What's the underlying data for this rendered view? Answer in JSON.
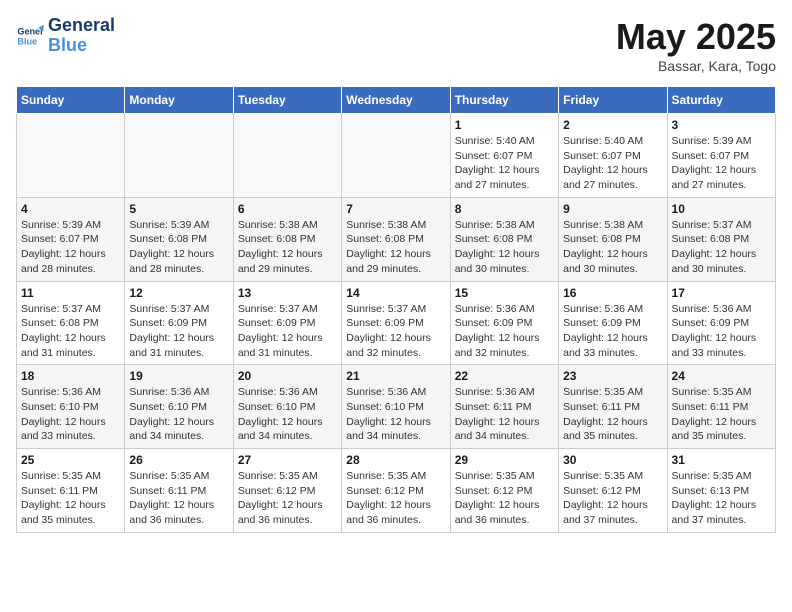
{
  "logo": {
    "line1": "General",
    "line2": "Blue"
  },
  "header": {
    "month": "May 2025",
    "location": "Bassar, Kara, Togo"
  },
  "weekdays": [
    "Sunday",
    "Monday",
    "Tuesday",
    "Wednesday",
    "Thursday",
    "Friday",
    "Saturday"
  ],
  "weeks": [
    [
      {
        "day": "",
        "info": ""
      },
      {
        "day": "",
        "info": ""
      },
      {
        "day": "",
        "info": ""
      },
      {
        "day": "",
        "info": ""
      },
      {
        "day": "1",
        "info": "Sunrise: 5:40 AM\nSunset: 6:07 PM\nDaylight: 12 hours and 27 minutes."
      },
      {
        "day": "2",
        "info": "Sunrise: 5:40 AM\nSunset: 6:07 PM\nDaylight: 12 hours and 27 minutes."
      },
      {
        "day": "3",
        "info": "Sunrise: 5:39 AM\nSunset: 6:07 PM\nDaylight: 12 hours and 27 minutes."
      }
    ],
    [
      {
        "day": "4",
        "info": "Sunrise: 5:39 AM\nSunset: 6:07 PM\nDaylight: 12 hours and 28 minutes."
      },
      {
        "day": "5",
        "info": "Sunrise: 5:39 AM\nSunset: 6:08 PM\nDaylight: 12 hours and 28 minutes."
      },
      {
        "day": "6",
        "info": "Sunrise: 5:38 AM\nSunset: 6:08 PM\nDaylight: 12 hours and 29 minutes."
      },
      {
        "day": "7",
        "info": "Sunrise: 5:38 AM\nSunset: 6:08 PM\nDaylight: 12 hours and 29 minutes."
      },
      {
        "day": "8",
        "info": "Sunrise: 5:38 AM\nSunset: 6:08 PM\nDaylight: 12 hours and 30 minutes."
      },
      {
        "day": "9",
        "info": "Sunrise: 5:38 AM\nSunset: 6:08 PM\nDaylight: 12 hours and 30 minutes."
      },
      {
        "day": "10",
        "info": "Sunrise: 5:37 AM\nSunset: 6:08 PM\nDaylight: 12 hours and 30 minutes."
      }
    ],
    [
      {
        "day": "11",
        "info": "Sunrise: 5:37 AM\nSunset: 6:08 PM\nDaylight: 12 hours and 31 minutes."
      },
      {
        "day": "12",
        "info": "Sunrise: 5:37 AM\nSunset: 6:09 PM\nDaylight: 12 hours and 31 minutes."
      },
      {
        "day": "13",
        "info": "Sunrise: 5:37 AM\nSunset: 6:09 PM\nDaylight: 12 hours and 31 minutes."
      },
      {
        "day": "14",
        "info": "Sunrise: 5:37 AM\nSunset: 6:09 PM\nDaylight: 12 hours and 32 minutes."
      },
      {
        "day": "15",
        "info": "Sunrise: 5:36 AM\nSunset: 6:09 PM\nDaylight: 12 hours and 32 minutes."
      },
      {
        "day": "16",
        "info": "Sunrise: 5:36 AM\nSunset: 6:09 PM\nDaylight: 12 hours and 33 minutes."
      },
      {
        "day": "17",
        "info": "Sunrise: 5:36 AM\nSunset: 6:09 PM\nDaylight: 12 hours and 33 minutes."
      }
    ],
    [
      {
        "day": "18",
        "info": "Sunrise: 5:36 AM\nSunset: 6:10 PM\nDaylight: 12 hours and 33 minutes."
      },
      {
        "day": "19",
        "info": "Sunrise: 5:36 AM\nSunset: 6:10 PM\nDaylight: 12 hours and 34 minutes."
      },
      {
        "day": "20",
        "info": "Sunrise: 5:36 AM\nSunset: 6:10 PM\nDaylight: 12 hours and 34 minutes."
      },
      {
        "day": "21",
        "info": "Sunrise: 5:36 AM\nSunset: 6:10 PM\nDaylight: 12 hours and 34 minutes."
      },
      {
        "day": "22",
        "info": "Sunrise: 5:36 AM\nSunset: 6:11 PM\nDaylight: 12 hours and 34 minutes."
      },
      {
        "day": "23",
        "info": "Sunrise: 5:35 AM\nSunset: 6:11 PM\nDaylight: 12 hours and 35 minutes."
      },
      {
        "day": "24",
        "info": "Sunrise: 5:35 AM\nSunset: 6:11 PM\nDaylight: 12 hours and 35 minutes."
      }
    ],
    [
      {
        "day": "25",
        "info": "Sunrise: 5:35 AM\nSunset: 6:11 PM\nDaylight: 12 hours and 35 minutes."
      },
      {
        "day": "26",
        "info": "Sunrise: 5:35 AM\nSunset: 6:11 PM\nDaylight: 12 hours and 36 minutes."
      },
      {
        "day": "27",
        "info": "Sunrise: 5:35 AM\nSunset: 6:12 PM\nDaylight: 12 hours and 36 minutes."
      },
      {
        "day": "28",
        "info": "Sunrise: 5:35 AM\nSunset: 6:12 PM\nDaylight: 12 hours and 36 minutes."
      },
      {
        "day": "29",
        "info": "Sunrise: 5:35 AM\nSunset: 6:12 PM\nDaylight: 12 hours and 36 minutes."
      },
      {
        "day": "30",
        "info": "Sunrise: 5:35 AM\nSunset: 6:12 PM\nDaylight: 12 hours and 37 minutes."
      },
      {
        "day": "31",
        "info": "Sunrise: 5:35 AM\nSunset: 6:13 PM\nDaylight: 12 hours and 37 minutes."
      }
    ]
  ]
}
